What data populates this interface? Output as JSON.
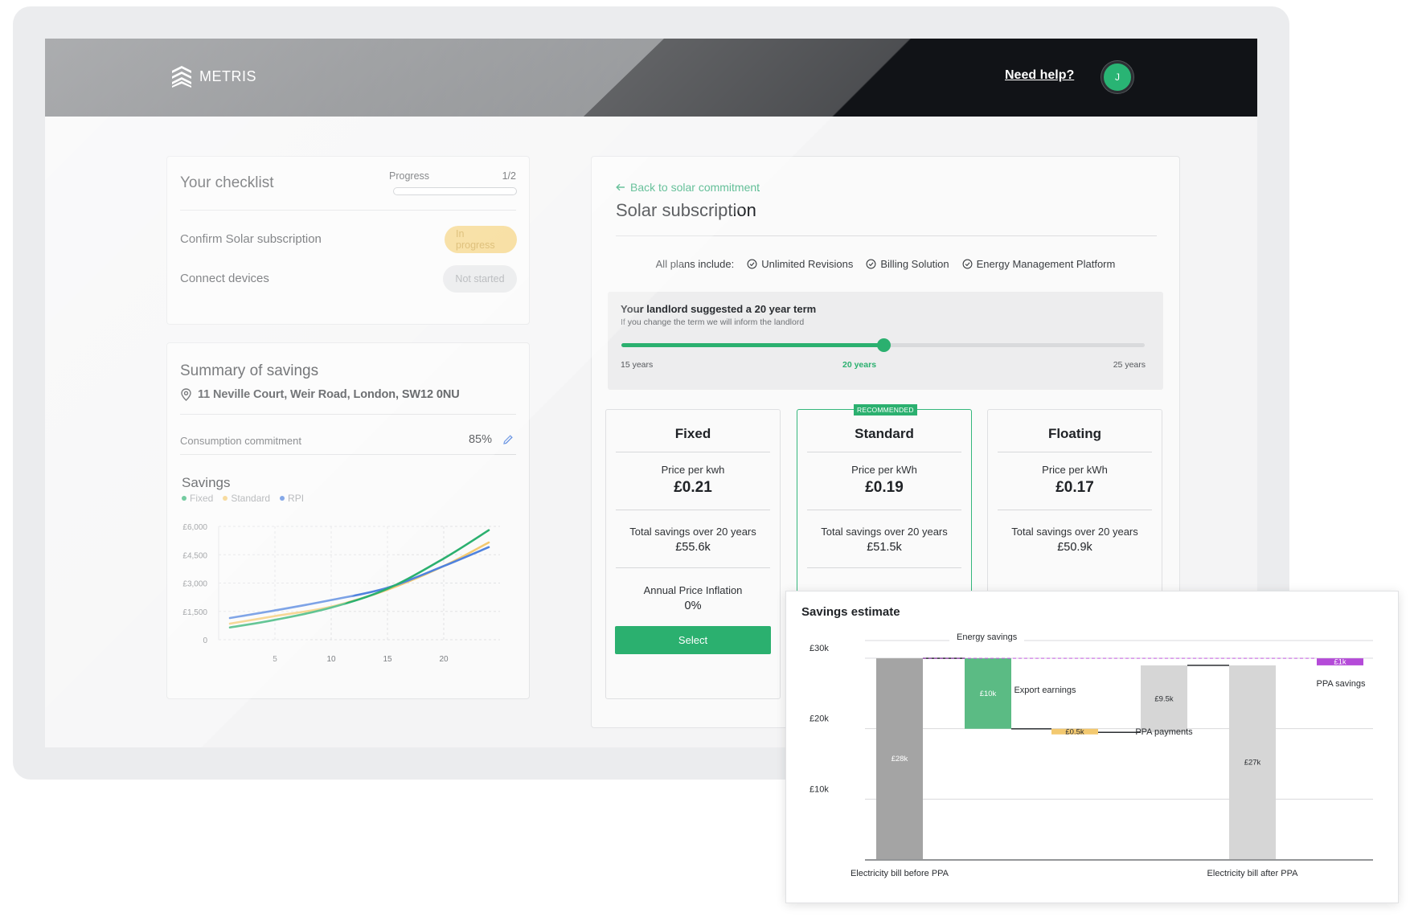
{
  "brand": {
    "name": "METRIS"
  },
  "header": {
    "help_link": "Need help?",
    "avatar_initial": "J"
  },
  "checklist": {
    "title": "Your checklist",
    "progress_label": "Progress",
    "progress_count": "1/2",
    "progress_fraction": 0.0,
    "tasks": [
      {
        "label": "Confirm Solar subscription",
        "status": "In progress"
      },
      {
        "label": "Connect devices",
        "status": "Not started"
      }
    ]
  },
  "summary": {
    "title": "Summary of savings",
    "address": "11 Neville Court, Weir Road, London, SW12 0NU",
    "consumption_label": "Consumption commitment",
    "consumption_value": "85%",
    "savings_title": "Savings",
    "legend": [
      {
        "name": "Fixed",
        "color": "#2bb06f"
      },
      {
        "name": "Standard",
        "color": "#f3c970"
      },
      {
        "name": "RPI",
        "color": "#4f82de"
      }
    ]
  },
  "main": {
    "back_link": "Back to solar commitment",
    "title": "Solar subscription",
    "includes_label": "All plans include:",
    "includes": [
      "Unlimited Revisions",
      "Billing Solution",
      "Energy Management Platform"
    ],
    "term": {
      "title": "Your landlord suggested a 20 year term",
      "subtitle": "If you change the term we will inform the landlord",
      "min_label": "15 years",
      "value_label": "20 years",
      "max_label": "25 years",
      "min": 15,
      "max": 25,
      "value": 20
    },
    "plans": [
      {
        "name": "Fixed",
        "price_label": "Price per kwh",
        "price": "£0.21",
        "savings_label": "Total savings over 20 years",
        "savings": "£55.6k",
        "inflation_label": "Annual Price Inflation",
        "inflation": "0%",
        "button": "Select",
        "recommended": false
      },
      {
        "name": "Standard",
        "price_label": "Price per kWh",
        "price": "£0.19",
        "savings_label": "Total savings over 20 years",
        "savings": "£51.5k",
        "badge": "RECOMMENDED",
        "recommended": true
      },
      {
        "name": "Floating",
        "price_label": "Price per kWh",
        "price": "£0.17",
        "savings_label": "Total savings over 20 years",
        "savings": "£50.9k",
        "recommended": false
      }
    ]
  },
  "chart_data": [
    {
      "type": "line",
      "title": "Savings",
      "x": [
        1,
        5,
        10,
        15,
        20,
        24
      ],
      "xticks": [
        "5",
        "10",
        "15",
        "20"
      ],
      "xtick_values": [
        5,
        10,
        15,
        20
      ],
      "yticks": [
        "£6,000",
        "£4,500",
        "£3,000",
        "£1,500",
        "0"
      ],
      "ytick_values": [
        6000,
        4500,
        3000,
        1500,
        0
      ],
      "xlim": [
        0,
        25
      ],
      "ylim": [
        0,
        6000
      ],
      "grid": true,
      "legend_position": "top-left",
      "series": [
        {
          "name": "Fixed",
          "color": "#2bb06f",
          "values": [
            650,
            1050,
            1700,
            2700,
            4300,
            5800
          ]
        },
        {
          "name": "Standard",
          "color": "#f3c970",
          "values": [
            850,
            1250,
            1750,
            2650,
            3900,
            5150
          ]
        },
        {
          "name": "RPI",
          "color": "#4f82de",
          "values": [
            1150,
            1550,
            2100,
            2750,
            3900,
            4900
          ]
        }
      ]
    },
    {
      "type": "bar",
      "title": "Savings estimate",
      "subtype": "waterfall",
      "ylim": [
        0,
        30000
      ],
      "yticks": [
        "£30k",
        "£20k",
        "£10k"
      ],
      "ytick_values": [
        30000,
        20000,
        10000
      ],
      "grid": true,
      "bars": [
        {
          "label": "£28k",
          "category": "Electricity bill before PPA",
          "start": 0,
          "end": 28500,
          "color": "#a4a4a4"
        },
        {
          "label": "£10k",
          "category": "Energy savings",
          "start": 28500,
          "end": 18500,
          "color": "#5bbb84"
        },
        {
          "label": "£0.5k",
          "category": "Export earnings",
          "start": 18500,
          "end": 18000,
          "color": "#f3c970"
        },
        {
          "label": "£9.5k",
          "category": "PPA payments",
          "start": 18000,
          "end": 27500,
          "color": "#d6d6d6"
        },
        {
          "label": "£27k",
          "category": "Electricity bill after PPA",
          "start": 0,
          "end": 27500,
          "color": "#d6d6d6"
        },
        {
          "label": "£1k",
          "category": "PPA savings",
          "start": 27500,
          "end": 28500,
          "color": "#b44bd8"
        }
      ],
      "annotations": [
        "Energy savings",
        "Export earnings",
        "PPA payments",
        "PPA savings",
        "Electricity bill before PPA",
        "Electricity bill after PPA"
      ]
    }
  ]
}
